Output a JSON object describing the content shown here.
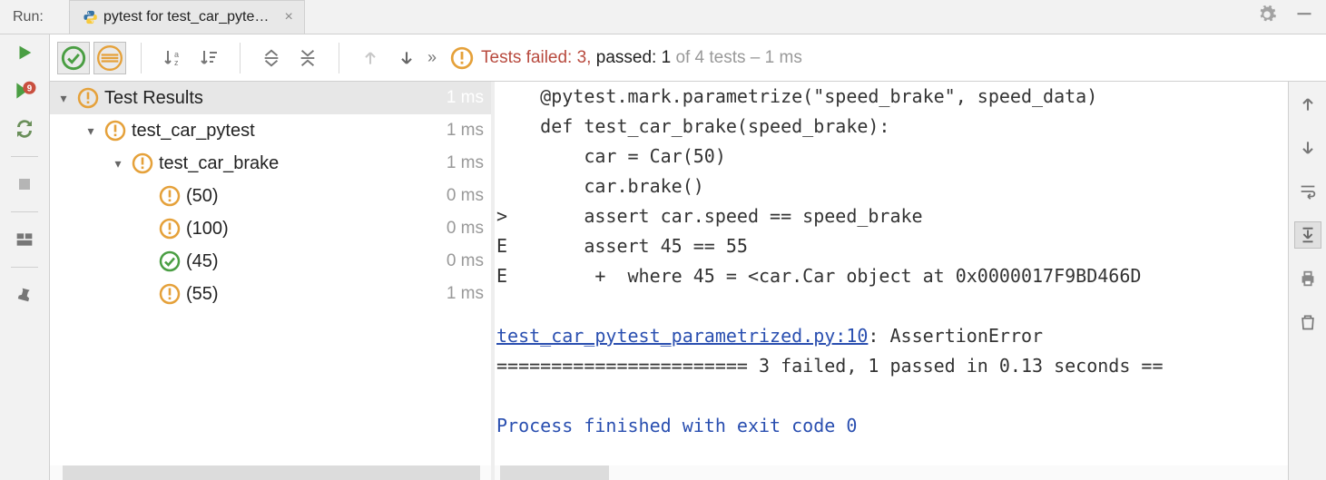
{
  "header": {
    "run_label": "Run:",
    "tab_title": "pytest for test_car_pytest.test_c..."
  },
  "toolbar": {
    "show_passed": true,
    "show_ignored": true,
    "sort_alpha": false,
    "sort_duration": false,
    "expand_all": false,
    "collapse_all": false,
    "prev_failed": false,
    "next_failed": false,
    "more": "»"
  },
  "status": {
    "failed_label": "Tests failed: 3,",
    "passed_label": "passed: 1",
    "rest_label": "of 4 tests – 1 ms"
  },
  "tree": {
    "root": {
      "label": "Test Results",
      "time": "1 ms",
      "status": "warn"
    },
    "nodes": [
      {
        "depth": 1,
        "expandable": true,
        "label": "test_car_pytest",
        "time": "1 ms",
        "status": "warn"
      },
      {
        "depth": 2,
        "expandable": true,
        "label": "test_car_brake",
        "time": "1 ms",
        "status": "warn"
      },
      {
        "depth": 3,
        "expandable": false,
        "label": "(50)",
        "time": "0 ms",
        "status": "warn"
      },
      {
        "depth": 3,
        "expandable": false,
        "label": "(100)",
        "time": "0 ms",
        "status": "warn"
      },
      {
        "depth": 3,
        "expandable": false,
        "label": "(45)",
        "time": "0 ms",
        "status": "pass"
      },
      {
        "depth": 3,
        "expandable": false,
        "label": "(55)",
        "time": "1 ms",
        "status": "warn"
      }
    ]
  },
  "console": {
    "l0": "    @pytest.mark.parametrize(\"speed_brake\", speed_data)",
    "l1": "    def test_car_brake(speed_brake):",
    "l2": "        car = Car(50)",
    "l3": "        car.brake()",
    "l4": ">       assert car.speed == speed_brake",
    "l5": "E       assert 45 == 55",
    "l6": "E        +  where 45 = <car.Car object at 0x0000017F9BD466D",
    "l7": "",
    "link": "test_car_pytest_parametrized.py:10",
    "l8_suffix": ": AssertionError",
    "l9": "======================= 3 failed, 1 passed in 0.13 seconds ==",
    "l10": "",
    "l11": "Process finished with exit code 0"
  },
  "icons": {
    "gear": "gear-icon",
    "minimize": "minimize-icon",
    "run": "run-icon",
    "rerun_failed": "rerun-failed-icon",
    "toggle_autotest": "toggle-autotest-icon",
    "stop": "stop-icon",
    "layout": "layout-icon",
    "pin": "pin-icon",
    "up": "up-arrow-icon",
    "down": "down-arrow-icon",
    "wrap": "softwrap-icon",
    "scroll_end": "scroll-end-icon",
    "print": "print-icon",
    "trash": "trash-icon"
  }
}
